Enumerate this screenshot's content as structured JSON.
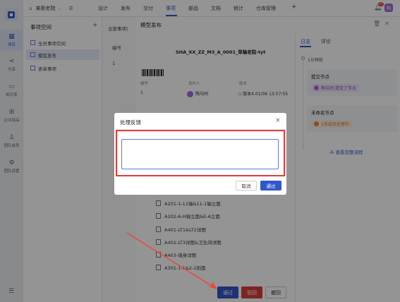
{
  "topbar": {
    "home_glyph": "⌂",
    "project": "某歌老院",
    "nav": [
      "设计",
      "发布",
      "交付",
      "事项",
      "部品",
      "文档",
      "统计",
      "仓库管理"
    ],
    "active_nav": "事项",
    "plus": "+",
    "notif_count": "17",
    "user_initial": "陶"
  },
  "rail": {
    "items": [
      {
        "label": "项目",
        "glyph": "▦"
      },
      {
        "label": "分享",
        "glyph": "⋖"
      },
      {
        "label": "知识库",
        "glyph": "▭"
      },
      {
        "label": "企业部品",
        "glyph": "⊞"
      },
      {
        "label": "团队成员",
        "glyph": "♙"
      },
      {
        "label": "团队设置",
        "glyph": "⚙"
      }
    ],
    "bottom_glyph": "☰"
  },
  "subpanel": {
    "title": "事项空间",
    "plus": "+",
    "items": [
      "全员事项空间",
      "模型发布",
      "表单事项"
    ]
  },
  "listcol": {
    "header": "全部事项(",
    "col": "编号",
    "row": "1"
  },
  "drawer": {
    "title": "模型发布",
    "doc_title": "SHA_XX_ZZ_M3_A_0001_草稿老院-tyt",
    "meta_headers": [
      "编号",
      "发布人",
      "版本"
    ],
    "meta_values": [
      "1",
      "陶与同",
      "版本4.01/06 13:57:55"
    ],
    "files": [
      "A201-1-11轴&11-1轴立面",
      "A202-A-H轴立面&E-A立面",
      "A401-LT1&LT2详图",
      "A402-LT3详图&卫生间详图",
      "A403-墙身详图",
      "A301-1-1&2-2剖面"
    ]
  },
  "rightpane": {
    "tabs": [
      "日志",
      "评论"
    ],
    "time": "1分钟前",
    "submit_node_title": "提交节点",
    "submit_pill": "陶与同 提交了节点",
    "pending_node_title": "未命名节点",
    "pending_pill": "1名成员处理中",
    "view_flow": "查看完整流程"
  },
  "bottom_buttons": {
    "pass": "通过",
    "reject": "驳回",
    "back": "撤回"
  },
  "modal": {
    "title": "处理反馈",
    "close": "×",
    "textarea_value": "",
    "cancel": "取消",
    "ok": "通过"
  },
  "colors": {
    "accent": "#3157c9",
    "danger": "#dc3b3b",
    "highlight": "#e23b3b"
  }
}
